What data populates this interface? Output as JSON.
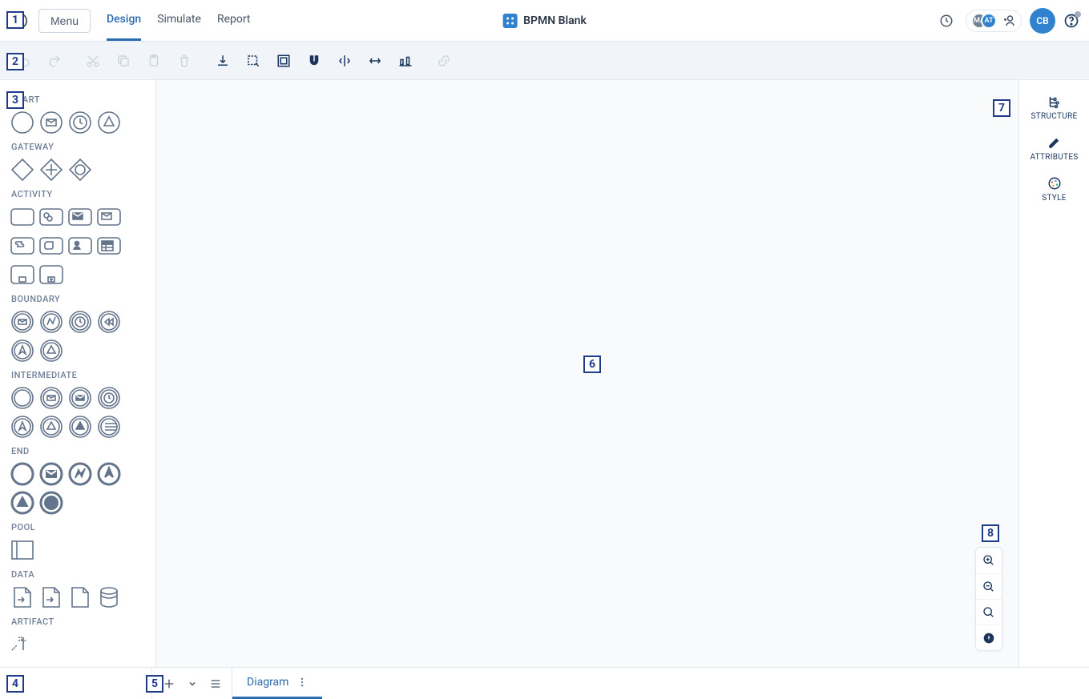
{
  "header": {
    "menu_label": "Menu",
    "tabs": [
      "Design",
      "Simulate",
      "Report"
    ],
    "active_tab_index": 0,
    "title": "BPMN Blank",
    "avatar_initials": "CB",
    "collab_avatars": [
      "MA",
      "AT"
    ]
  },
  "toolbar": {
    "items": [
      {
        "name": "undo-icon",
        "enabled": false
      },
      {
        "name": "redo-icon",
        "enabled": false
      },
      {
        "name": "cut-icon",
        "enabled": false
      },
      {
        "name": "copy-icon",
        "enabled": false
      },
      {
        "name": "paste-icon",
        "enabled": false
      },
      {
        "name": "delete-icon",
        "enabled": false
      },
      {
        "name": "download-icon",
        "enabled": true
      },
      {
        "name": "select-area-icon",
        "enabled": true
      },
      {
        "name": "group-icon",
        "enabled": true
      },
      {
        "name": "magnet-icon",
        "enabled": true
      },
      {
        "name": "align-h-icon",
        "enabled": true
      },
      {
        "name": "align-v-icon",
        "enabled": true
      },
      {
        "name": "distribute-icon",
        "enabled": true
      },
      {
        "name": "link-icon",
        "enabled": false
      }
    ]
  },
  "palette": {
    "groups": [
      {
        "label": "START",
        "shapes": [
          "start-none",
          "start-message",
          "start-timer",
          "start-signal"
        ]
      },
      {
        "label": "GATEWAY",
        "shapes": [
          "gateway-exclusive",
          "gateway-parallel",
          "gateway-inclusive"
        ]
      },
      {
        "label": "ACTIVITY",
        "shapes": [
          "task",
          "service-task",
          "send-task",
          "receive-task",
          "script-task",
          "manual-task",
          "user-task",
          "business-rule-task",
          "subprocess-collapsed",
          "subprocess-expanded"
        ]
      },
      {
        "label": "BOUNDARY",
        "shapes": [
          "boundary-message",
          "boundary-error",
          "boundary-timer",
          "boundary-compensation",
          "boundary-escalation",
          "boundary-signal"
        ]
      },
      {
        "label": "INTERMEDIATE",
        "shapes": [
          "intermediate-none",
          "intermediate-message-catch",
          "intermediate-message-throw",
          "intermediate-timer",
          "intermediate-escalation-catch",
          "intermediate-signal-catch",
          "intermediate-signal-throw",
          "intermediate-link"
        ]
      },
      {
        "label": "END",
        "shapes": [
          "end-none",
          "end-message",
          "end-error",
          "end-escalation",
          "end-signal",
          "end-terminate"
        ]
      },
      {
        "label": "POOL",
        "shapes": [
          "pool"
        ]
      },
      {
        "label": "DATA",
        "shapes": [
          "data-input",
          "data-output",
          "data-object",
          "data-store"
        ]
      },
      {
        "label": "ARTIFACT",
        "shapes": [
          "text-annotation"
        ]
      }
    ]
  },
  "right_panel": {
    "items": [
      {
        "name": "structure",
        "label": "STRUCTURE"
      },
      {
        "name": "attributes",
        "label": "ATTRIBUTES"
      },
      {
        "name": "style",
        "label": "STYLE"
      }
    ]
  },
  "zoom": {
    "items": [
      "zoom-in",
      "zoom-out",
      "zoom-fit",
      "compass"
    ]
  },
  "footer": {
    "tab_label": "Diagram"
  },
  "callouts": [
    "1",
    "2",
    "3",
    "4",
    "5",
    "6",
    "7",
    "8"
  ]
}
